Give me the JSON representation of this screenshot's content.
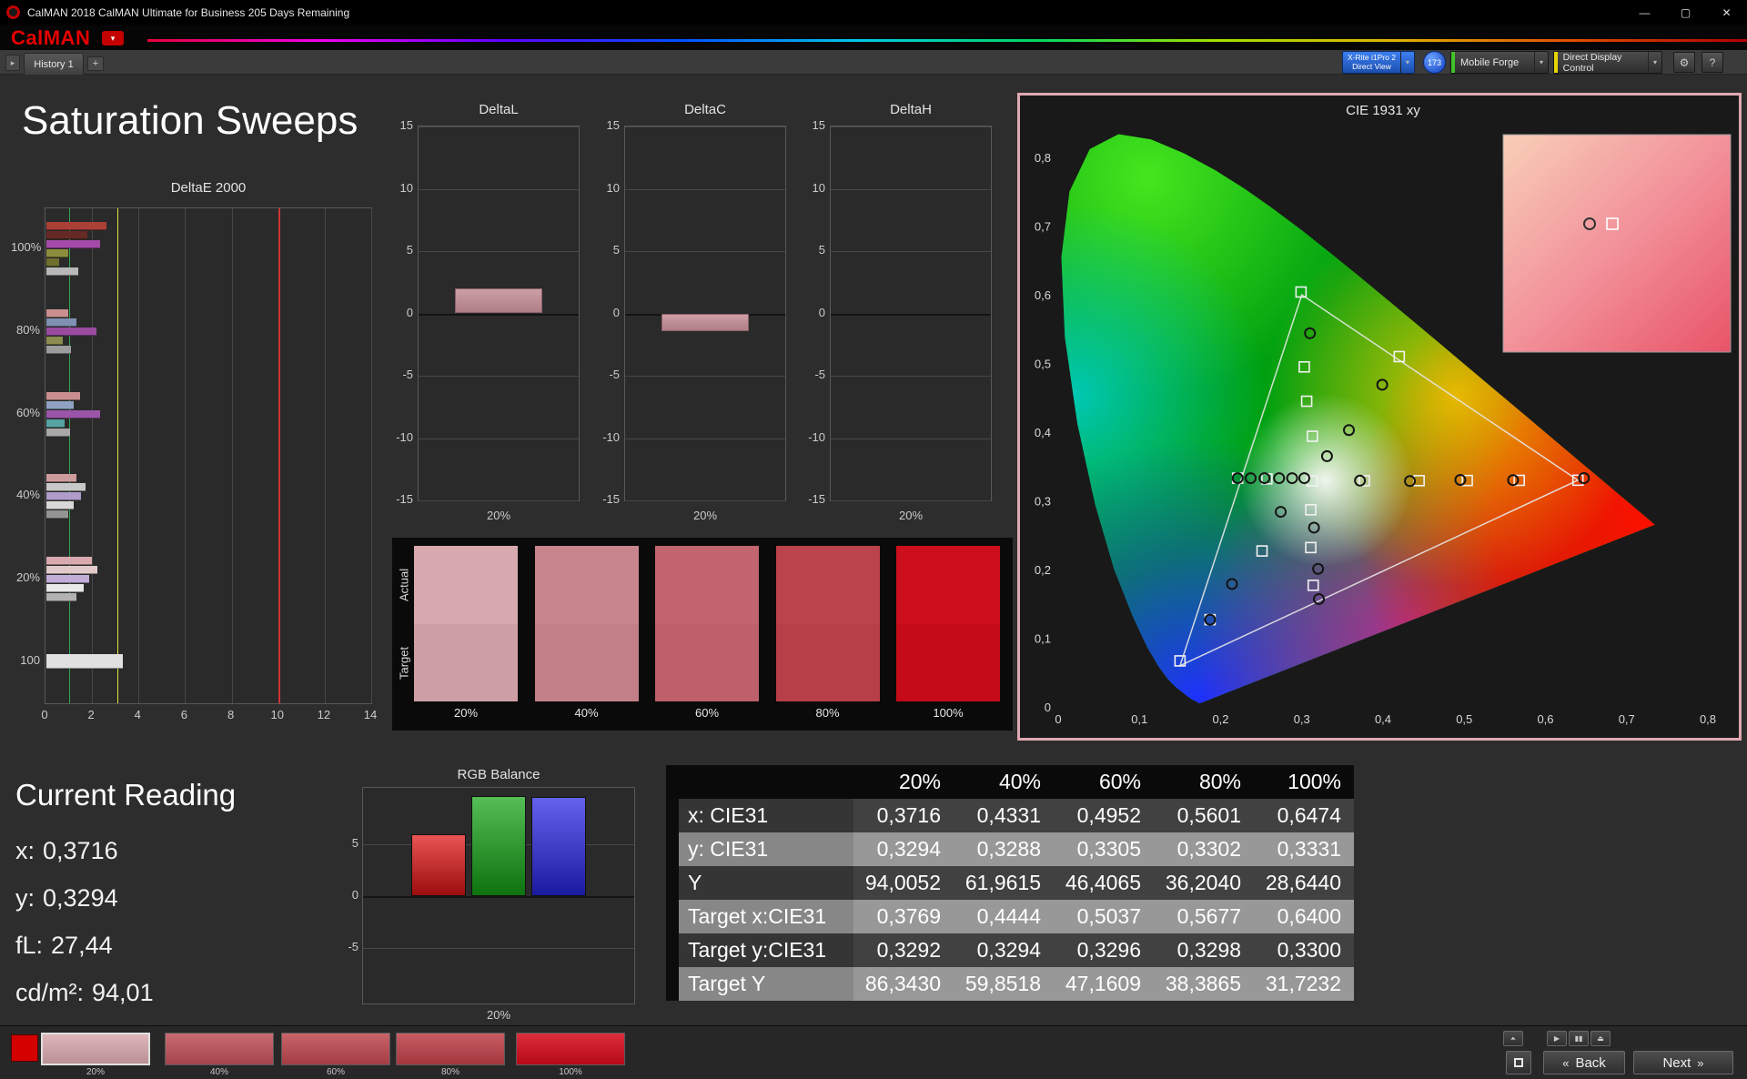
{
  "window": {
    "title": "CalMAN 2018 CalMAN Ultimate for Business 205 Days Remaining",
    "controls": {
      "minimize": "—",
      "maximize": "▢",
      "close": "✕"
    }
  },
  "logo_bar": {
    "brand": "CalMAN",
    "dropdown_arrow": "▾"
  },
  "tab_bar": {
    "nav_arrow": "▸",
    "tabs": [
      {
        "label": "History 1",
        "active": true
      }
    ],
    "add_tab": "+",
    "chevron": "▾",
    "meter_button": {
      "line1": "X-Rite i1Pro 2",
      "line2": "Direct View"
    },
    "badge": "173",
    "source_button": "Mobile Forge",
    "source_stripe_color": "#41c229",
    "display_button": "Direct Display Control",
    "display_stripe_color": "#e8d400",
    "gear": "⚙",
    "help": "?"
  },
  "page_title": "Saturation Sweeps",
  "current_reading": {
    "title": "Current Reading",
    "lines": [
      {
        "label": "x:",
        "value": "0,3716"
      },
      {
        "label": "y:",
        "value": "0,3294"
      },
      {
        "label": "fL:",
        "value": "27,44"
      },
      {
        "label": "cd/m²:",
        "value": "94,01"
      }
    ]
  },
  "swatch_panel": {
    "row_labels": [
      "Actual",
      "Target"
    ],
    "swatches": [
      {
        "label": "20%",
        "actual": "#d7a9ae",
        "target": "#cf9fa6"
      },
      {
        "label": "40%",
        "actual": "#c8858e",
        "target": "#c37f88"
      },
      {
        "label": "60%",
        "actual": "#c2656e",
        "target": "#bd6069"
      },
      {
        "label": "80%",
        "actual": "#ba434c",
        "target": "#b73f48"
      },
      {
        "label": "100%",
        "actual": "#cd0f1d",
        "target": "#c50b19"
      }
    ]
  },
  "bottom_bar": {
    "preview_color": "#d40000",
    "patches": [
      {
        "label": "20%",
        "color": "#d9aaae",
        "selected": true
      },
      {
        "label": "40%",
        "color": "#c05059",
        "selected": false
      },
      {
        "label": "60%",
        "color": "#bf4850",
        "selected": false
      },
      {
        "label": "80%",
        "color": "#be4049",
        "selected": false
      },
      {
        "label": "100%",
        "color": "#d60a1a",
        "selected": false
      }
    ],
    "small_buttons": [
      {
        "name": "collapse-panel-button",
        "glyph": "⏶"
      },
      {
        "name": "play-button",
        "glyph": "▶"
      },
      {
        "name": "pause-button",
        "glyph": "▮▮"
      },
      {
        "name": "eject-button",
        "glyph": "⏏"
      }
    ],
    "back_button": {
      "icon": "«",
      "label": "Back"
    },
    "next_button": {
      "label": "Next",
      "icon": "»"
    }
  },
  "chart_data": [
    {
      "id": "deltae2000",
      "type": "bar",
      "orientation": "horizontal",
      "title": "DeltaE 2000",
      "xlim": [
        0,
        14
      ],
      "xticks": [
        0,
        2,
        4,
        6,
        8,
        10,
        12,
        14
      ],
      "reference_lines": [
        {
          "value": 1.0,
          "color": "#2fa84f"
        },
        {
          "value": 3.1,
          "color": "#e6e63c"
        },
        {
          "value": 10.0,
          "color": "#cc3333"
        }
      ],
      "groups": [
        {
          "label": "100%",
          "bars": [
            {
              "color": "#aa4038",
              "value": 2.6
            },
            {
              "color": "#652a26",
              "value": 1.75
            },
            {
              "color": "#a44aa8",
              "value": 2.3
            },
            {
              "color": "#8d8d3e",
              "value": 0.95
            },
            {
              "color": "#6f6f30",
              "value": 0.55
            },
            {
              "color": "#b8b8b8",
              "value": 1.35
            }
          ]
        },
        {
          "label": "80%",
          "bars": [
            {
              "color": "#c98f8f",
              "value": 0.92
            },
            {
              "color": "#8090b2",
              "value": 1.3
            },
            {
              "color": "#9a4ba0",
              "value": 2.15
            },
            {
              "color": "#8c8c50",
              "value": 0.72
            },
            {
              "color": "#9c9c9c",
              "value": 1.05
            }
          ]
        },
        {
          "label": "60%",
          "bars": [
            {
              "color": "#c98f8f",
              "value": 1.45
            },
            {
              "color": "#90a2c2",
              "value": 1.18
            },
            {
              "color": "#9a55a8",
              "value": 2.3
            },
            {
              "color": "#57a2a2",
              "value": 0.78
            },
            {
              "color": "#a8a8a8",
              "value": 1.0
            }
          ]
        },
        {
          "label": "40%",
          "bars": [
            {
              "color": "#cc9c9c",
              "value": 1.3
            },
            {
              "color": "#c8c8c8",
              "value": 1.68
            },
            {
              "color": "#b09cc8",
              "value": 1.5
            },
            {
              "color": "#d8d8d8",
              "value": 1.18
            },
            {
              "color": "#949494",
              "value": 0.95
            }
          ]
        },
        {
          "label": "20%",
          "bars": [
            {
              "color": "#d8aab0",
              "value": 1.95
            },
            {
              "color": "#e2caca",
              "value": 2.2
            },
            {
              "color": "#c2acd8",
              "value": 1.85
            },
            {
              "color": "#e8e8e8",
              "value": 1.6
            },
            {
              "color": "#b2b2b2",
              "value": 1.3
            }
          ]
        },
        {
          "label": "100",
          "bars": [
            {
              "color": "#e0e0e0",
              "value": 3.3
            }
          ]
        }
      ]
    },
    {
      "id": "deltal",
      "type": "bar",
      "title": "DeltaL",
      "categories": [
        "20%"
      ],
      "values": [
        2.0
      ],
      "ylim": [
        -15,
        15
      ],
      "yticks": [
        15,
        10,
        5,
        0,
        -5,
        -10,
        -15
      ],
      "bar_color": "#c79199"
    },
    {
      "id": "deltac",
      "type": "bar",
      "title": "DeltaC",
      "categories": [
        "20%"
      ],
      "values": [
        -1.4
      ],
      "ylim": [
        -15,
        15
      ],
      "yticks": [
        15,
        10,
        5,
        0,
        -5,
        -10,
        -15
      ],
      "bar_color": "#c79199"
    },
    {
      "id": "deltah",
      "type": "bar",
      "title": "DeltaH",
      "categories": [
        "20%"
      ],
      "values": [
        0
      ],
      "ylim": [
        -15,
        15
      ],
      "yticks": [
        15,
        10,
        5,
        0,
        -5,
        -10,
        -15
      ],
      "bar_color": "#c79199"
    },
    {
      "id": "rgb_balance",
      "type": "bar",
      "title": "RGB Balance",
      "categories": [
        "20%"
      ],
      "series": [
        {
          "name": "Red",
          "color": "#e01212",
          "value": 6.0
        },
        {
          "name": "Green",
          "color": "#14a414",
          "value": 9.7
        },
        {
          "name": "Blue",
          "color": "#2626e6",
          "value": 9.6
        }
      ],
      "ylim": [
        -10.4,
        10.5
      ],
      "yticks": [
        5,
        0,
        -5
      ]
    },
    {
      "id": "cie1931",
      "type": "scatter",
      "title": "CIE 1931 xy",
      "xlim": [
        0,
        0.8
      ],
      "ylim": [
        0,
        0.8
      ],
      "xtick_labels": [
        "0",
        "0,1",
        "0,2",
        "0,3",
        "0,4",
        "0,5",
        "0,6",
        "0,7",
        "0,8"
      ],
      "ytick_labels": [
        "0",
        "0,1",
        "0,2",
        "0,3",
        "0,4",
        "0,5",
        "0,6",
        "0,7",
        "0,8"
      ],
      "gamut_triangle": [
        [
          0.64,
          0.33
        ],
        [
          0.3,
          0.6
        ],
        [
          0.15,
          0.06
        ]
      ],
      "spectral_locus": [
        [
          0.1741,
          0.005
        ],
        [
          0.169,
          0.0085
        ],
        [
          0.1644,
          0.0109
        ],
        [
          0.1566,
          0.0177
        ],
        [
          0.144,
          0.0297
        ],
        [
          0.1355,
          0.0399
        ],
        [
          0.1241,
          0.0578
        ],
        [
          0.1096,
          0.0868
        ],
        [
          0.0913,
          0.1327
        ],
        [
          0.0687,
          0.2007
        ],
        [
          0.0454,
          0.295
        ],
        [
          0.0235,
          0.4127
        ],
        [
          0.0082,
          0.5384
        ],
        [
          0.0039,
          0.6548
        ],
        [
          0.0139,
          0.7502
        ],
        [
          0.0389,
          0.812
        ],
        [
          0.0743,
          0.8338
        ],
        [
          0.1142,
          0.8262
        ],
        [
          0.1547,
          0.8059
        ],
        [
          0.1929,
          0.7816
        ],
        [
          0.2296,
          0.7543
        ],
        [
          0.2658,
          0.7243
        ],
        [
          0.3016,
          0.6923
        ],
        [
          0.3373,
          0.6589
        ],
        [
          0.3731,
          0.6245
        ],
        [
          0.4087,
          0.5896
        ],
        [
          0.4441,
          0.5547
        ],
        [
          0.4788,
          0.5202
        ],
        [
          0.5125,
          0.4866
        ],
        [
          0.5448,
          0.4544
        ],
        [
          0.5752,
          0.4242
        ],
        [
          0.6029,
          0.3965
        ],
        [
          0.627,
          0.3725
        ],
        [
          0.6482,
          0.3514
        ],
        [
          0.6658,
          0.334
        ],
        [
          0.6915,
          0.3083
        ],
        [
          0.7079,
          0.292
        ],
        [
          0.719,
          0.2809
        ],
        [
          0.726,
          0.274
        ],
        [
          0.7347,
          0.2653
        ]
      ],
      "targets": [
        [
          0.221,
          0.333
        ],
        [
          0.257,
          0.332
        ],
        [
          0.3127,
          0.329
        ],
        [
          0.3769,
          0.3292
        ],
        [
          0.4444,
          0.3294
        ],
        [
          0.5037,
          0.3296
        ],
        [
          0.5677,
          0.3298
        ],
        [
          0.64,
          0.33
        ],
        [
          0.313,
          0.394
        ],
        [
          0.306,
          0.445
        ],
        [
          0.303,
          0.495
        ],
        [
          0.299,
          0.604
        ],
        [
          0.42,
          0.51
        ],
        [
          0.311,
          0.287
        ],
        [
          0.311,
          0.232
        ],
        [
          0.314,
          0.177
        ],
        [
          0.251,
          0.227
        ],
        [
          0.187,
          0.127
        ],
        [
          0.15,
          0.067
        ]
      ],
      "measured": [
        [
          0.221,
          0.333
        ],
        [
          0.237,
          0.333
        ],
        [
          0.254,
          0.333
        ],
        [
          0.272,
          0.333
        ],
        [
          0.288,
          0.333
        ],
        [
          0.303,
          0.333
        ],
        [
          0.3716,
          0.3294
        ],
        [
          0.4331,
          0.3288
        ],
        [
          0.4952,
          0.3305
        ],
        [
          0.5601,
          0.3302
        ],
        [
          0.6474,
          0.3331
        ],
        [
          0.331,
          0.365
        ],
        [
          0.358,
          0.403
        ],
        [
          0.399,
          0.469
        ],
        [
          0.31,
          0.544
        ],
        [
          0.315,
          0.261
        ],
        [
          0.32,
          0.201
        ],
        [
          0.321,
          0.157
        ],
        [
          0.274,
          0.284
        ],
        [
          0.214,
          0.179
        ],
        [
          0.187,
          0.127
        ]
      ],
      "inset": {
        "colors": [
          "#f8cfb8",
          "#f2929a",
          "#e85468"
        ],
        "circle_rel": [
          0.38,
          0.41
        ],
        "square_rel": [
          0.48,
          0.41
        ]
      }
    },
    {
      "id": "results_table",
      "type": "table",
      "columns": [
        "20%",
        "40%",
        "60%",
        "80%",
        "100%"
      ],
      "rows": [
        {
          "label": "x: CIE31",
          "values": [
            "0,3716",
            "0,4331",
            "0,4952",
            "0,5601",
            "0,6474"
          ]
        },
        {
          "label": "y: CIE31",
          "values": [
            "0,3294",
            "0,3288",
            "0,3305",
            "0,3302",
            "0,3331"
          ]
        },
        {
          "label": "Y",
          "values": [
            "94,0052",
            "61,9615",
            "46,4065",
            "36,2040",
            "28,6440"
          ]
        },
        {
          "label": "Target x:CIE31",
          "values": [
            "0,3769",
            "0,4444",
            "0,5037",
            "0,5677",
            "0,6400"
          ]
        },
        {
          "label": "Target y:CIE31",
          "values": [
            "0,3292",
            "0,3294",
            "0,3296",
            "0,3298",
            "0,3300"
          ]
        },
        {
          "label": "Target Y",
          "values": [
            "86,3430",
            "59,8518",
            "47,1609",
            "38,3865",
            "31,7232"
          ]
        }
      ]
    }
  ]
}
